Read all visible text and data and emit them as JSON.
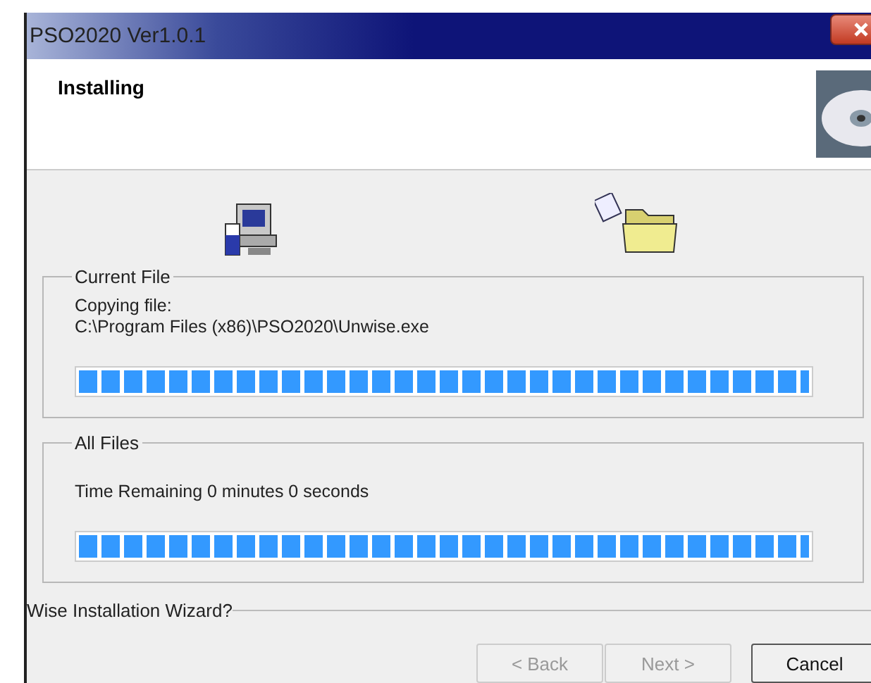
{
  "window": {
    "title": "PSO2020 Ver1.0.1"
  },
  "header": {
    "title": "Installing"
  },
  "groups": [
    {
      "title": "Current File",
      "lines": [
        "Copying file:",
        "C:\\Program Files (x86)\\PSO2020\\Unwise.exe"
      ],
      "level": 1
    },
    {
      "title": "All Files",
      "lines": [
        "Time Remaining 0 minutes 0 seconds"
      ],
      "level": 1
    }
  ],
  "footer": {
    "label": "Wise Installation Wizard?"
  },
  "buttons": [
    {
      "label": "< Back",
      "disabled": true
    },
    {
      "label": "Next >",
      "disabled": true
    },
    {
      "label": "Cancel",
      "disabled": false
    }
  ]
}
